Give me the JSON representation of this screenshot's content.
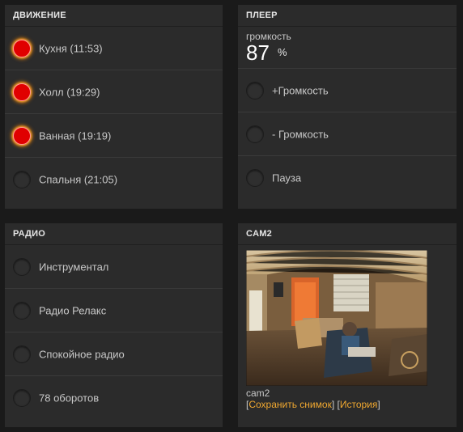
{
  "motion": {
    "title": "ДВИЖЕНИЕ",
    "items": [
      {
        "label": "Кухня (11:53)",
        "active": true
      },
      {
        "label": "Холл (19:29)",
        "active": true
      },
      {
        "label": "Ванная (19:19)",
        "active": true
      },
      {
        "label": "Спальня (21:05)",
        "active": false
      }
    ]
  },
  "player": {
    "title": "ПЛЕЕР",
    "volume_caption": "громкость",
    "volume_value": "87",
    "volume_unit": "%",
    "items": [
      {
        "label": "+Громкость"
      },
      {
        "label": "- Громкость"
      },
      {
        "label": "Пауза"
      }
    ]
  },
  "radio": {
    "title": "РАДИО",
    "items": [
      {
        "label": "Инструментал"
      },
      {
        "label": "Радио Релакс"
      },
      {
        "label": "Спокойное радио"
      },
      {
        "label": "78 оборотов"
      }
    ]
  },
  "cam": {
    "title": "CAM2",
    "caption": "cam2",
    "save_link": "Сохранить снимок",
    "history_link": "История",
    "bracket_open": "[",
    "bracket_close": "]",
    "separator": " "
  },
  "colors": {
    "page_bg": "#1a1a1a",
    "panel_bg": "#2b2b2b",
    "active_dot": "#e00000",
    "link": "#f0a830"
  }
}
